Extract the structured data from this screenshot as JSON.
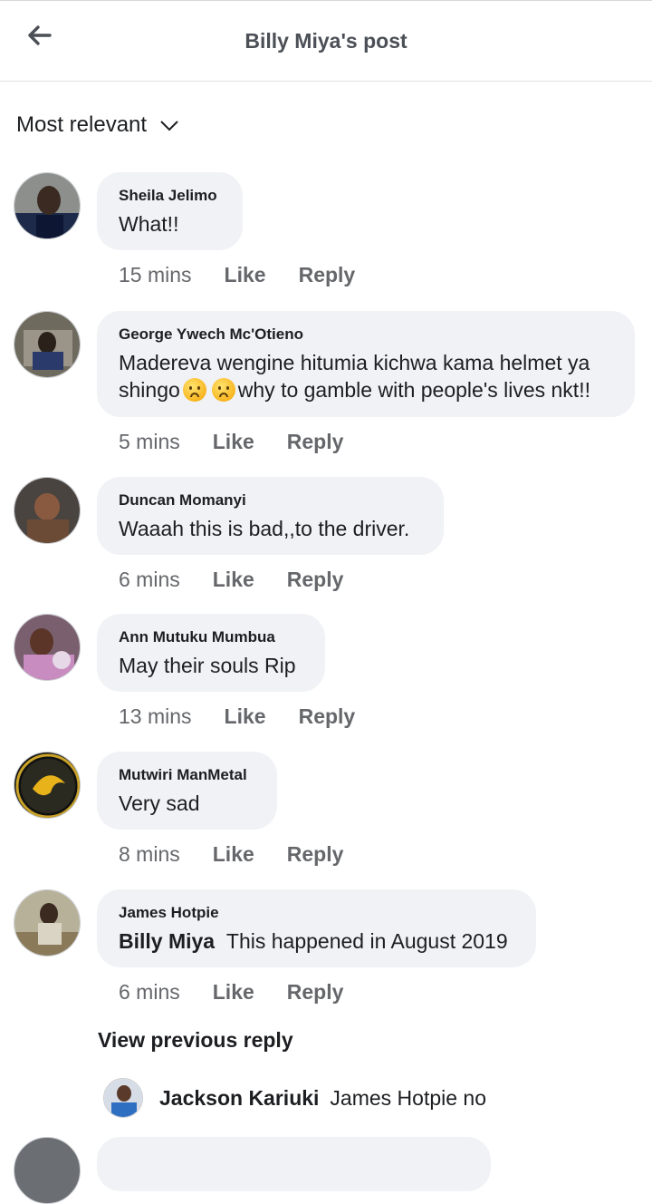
{
  "header": {
    "title": "Billy Miya's post",
    "back_icon": "arrow-left-icon"
  },
  "sort": {
    "label": "Most relevant",
    "icon": "chevron-down-icon"
  },
  "comments": [
    {
      "author": "Sheila Jelimo",
      "text": "What!!",
      "time": "15 mins",
      "like": "Like",
      "reply": "Reply"
    },
    {
      "author": "George Ywech Mc'Otieno",
      "text_line1": "Madereva wengine hitumia kichwa kama helmet ya",
      "text_line2_a": "shingo",
      "text_line2_b": "why to gamble with people's lives nkt!!",
      "time": "5 mins",
      "like": "Like",
      "reply": "Reply"
    },
    {
      "author": "Duncan Momanyi",
      "text": "Waaah this is bad,,to the driver.",
      "time": "6 mins",
      "like": "Like",
      "reply": "Reply"
    },
    {
      "author": "Ann Mutuku Mumbua",
      "text": "May their souls Rip",
      "time": "13 mins",
      "like": "Like",
      "reply": "Reply"
    },
    {
      "author": "Mutwiri ManMetal",
      "text": "Very sad",
      "time": "8 mins",
      "like": "Like",
      "reply": "Reply"
    },
    {
      "author": "James Hotpie",
      "mention": "Billy Miya",
      "text": "This happened in August 2019",
      "time": "6 mins",
      "like": "Like",
      "reply": "Reply"
    }
  ],
  "view_previous": "View previous reply",
  "reply": {
    "author": "Jackson Kariuki",
    "text": "James Hotpie no"
  },
  "colors": {
    "bubble": "#f0f2f5",
    "meta": "#65676b",
    "text": "#1c1e21"
  }
}
